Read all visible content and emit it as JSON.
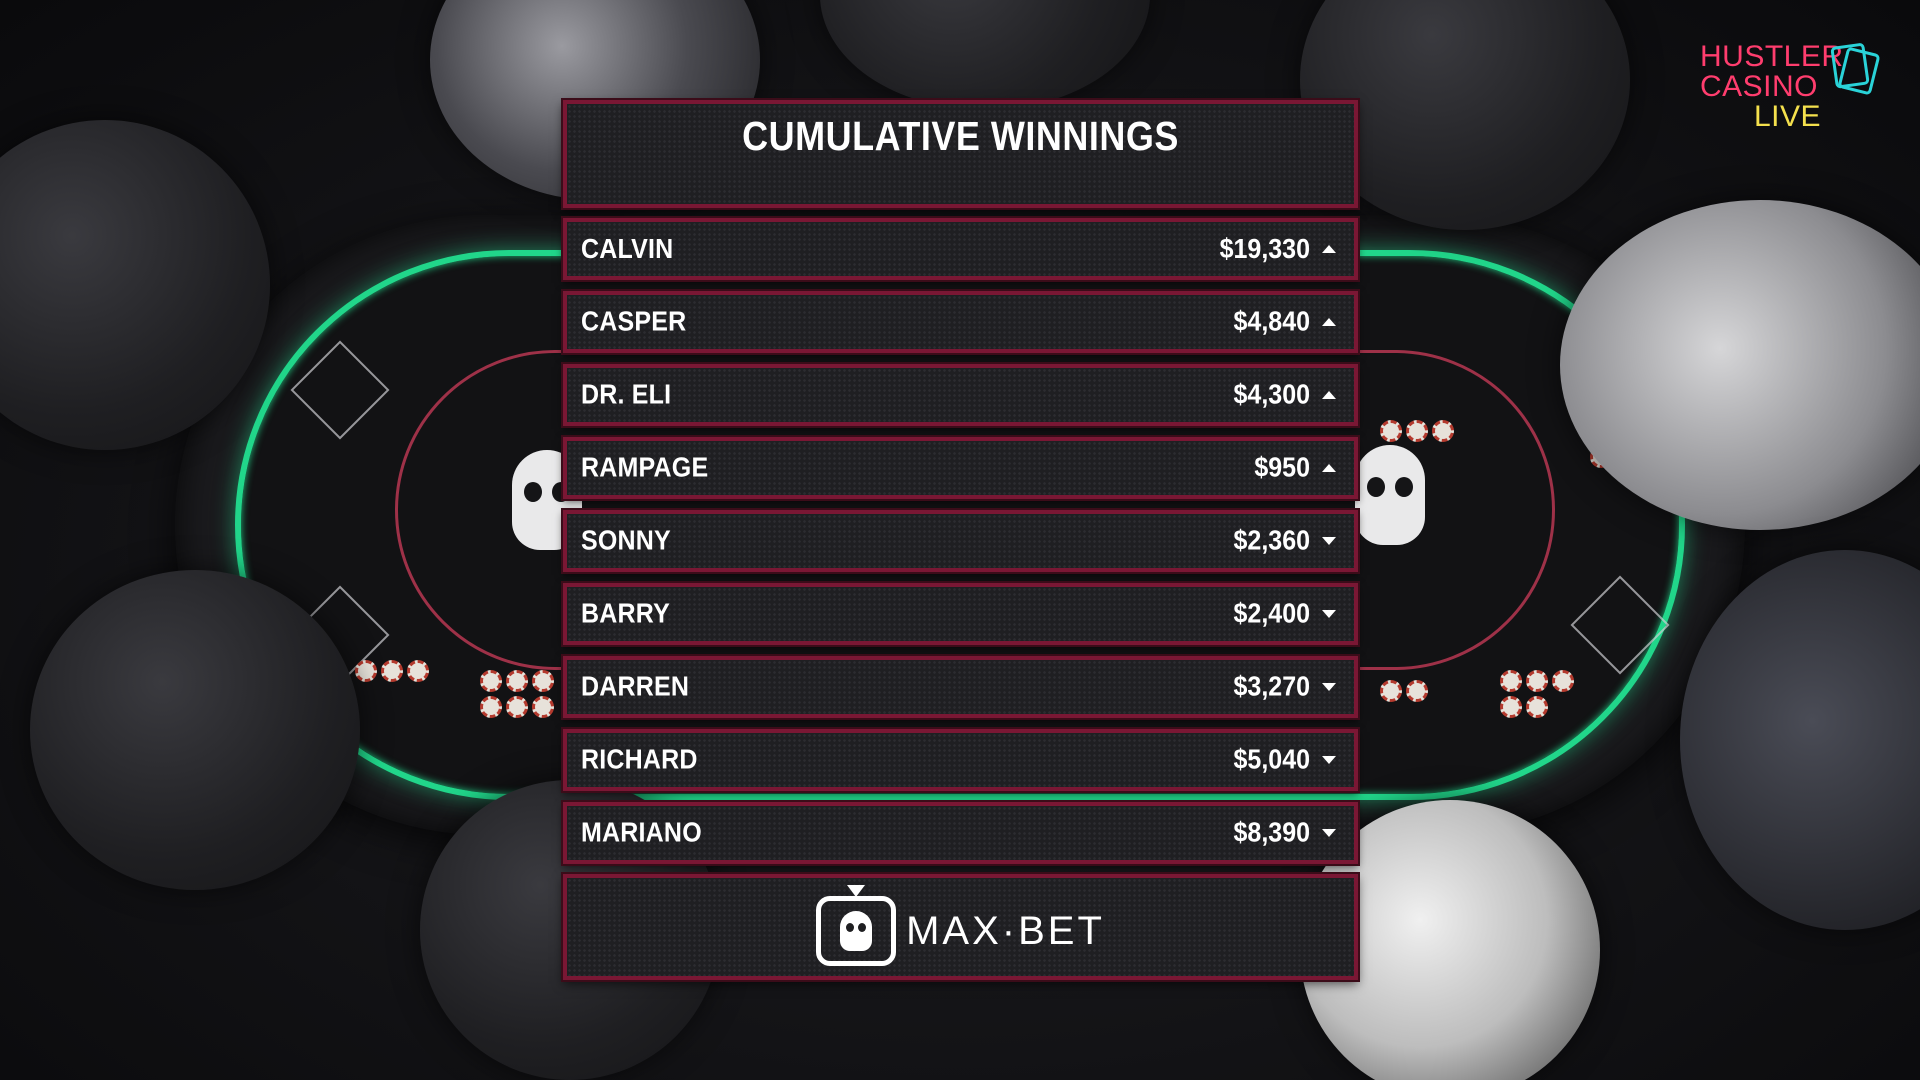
{
  "overlay": {
    "title": "CUMULATIVE WINNINGS",
    "players": [
      {
        "name": "CALVIN",
        "amount": "$19,330",
        "trend": "up"
      },
      {
        "name": "CASPER",
        "amount": "$4,840",
        "trend": "up"
      },
      {
        "name": "DR. ELI",
        "amount": "$4,300",
        "trend": "up"
      },
      {
        "name": "RAMPAGE",
        "amount": "$950",
        "trend": "up"
      },
      {
        "name": "SONNY",
        "amount": "$2,360",
        "trend": "down"
      },
      {
        "name": "BARRY",
        "amount": "$2,400",
        "trend": "down"
      },
      {
        "name": "DARREN",
        "amount": "$3,270",
        "trend": "down"
      },
      {
        "name": "RICHARD",
        "amount": "$5,040",
        "trend": "down"
      },
      {
        "name": "MARIANO",
        "amount": "$8,390",
        "trend": "down"
      }
    ],
    "sponsor": {
      "label": "MAX·BET",
      "icon": "tv-skull-icon"
    }
  },
  "brand": {
    "line1": "HUSTLER",
    "line2": "CASINO",
    "line3": "LIVE",
    "icon": "playing-cards-icon",
    "colors": {
      "primary": "#ff3d6e",
      "secondary": "#f4e04d",
      "accent": "#2ad3d8"
    }
  },
  "theme": {
    "panel_border": "#7a1734",
    "panel_fill": "#1f1f22",
    "text": "#ffffff",
    "table_glow": "#21d68a",
    "table_line": "#c23a55"
  }
}
